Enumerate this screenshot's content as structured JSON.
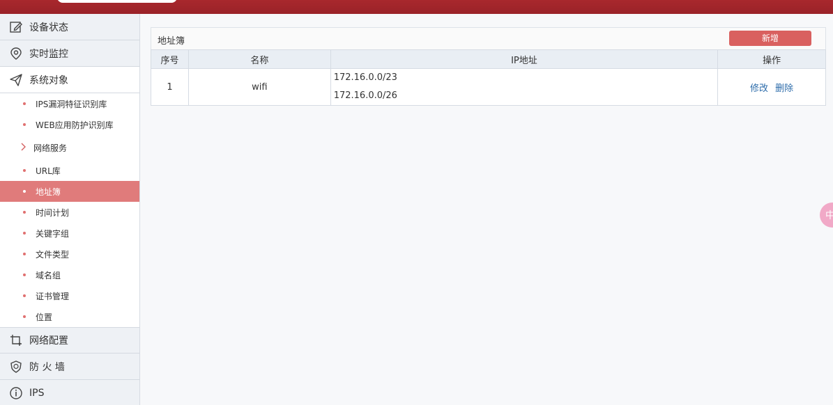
{
  "sidebar": {
    "top_items": [
      {
        "label": "设备状态",
        "icon": "edit-icon"
      },
      {
        "label": "实时监控",
        "icon": "location-pin-icon"
      },
      {
        "label": "系统对象",
        "icon": "paper-plane-icon"
      }
    ],
    "sub_items": [
      {
        "label": "IPS漏洞特征识别库"
      },
      {
        "label": "WEB应用防护识别库"
      },
      {
        "label": "网络服务"
      },
      {
        "label": "URL库"
      },
      {
        "label": "地址簿"
      },
      {
        "label": "时间计划"
      },
      {
        "label": "关键字组"
      },
      {
        "label": "文件类型"
      },
      {
        "label": "域名组"
      },
      {
        "label": "证书管理"
      },
      {
        "label": "位置"
      }
    ],
    "bottom_items": [
      {
        "label": "网络配置",
        "icon": "crop-icon"
      },
      {
        "label": "防 火 墙",
        "icon": "shield-icon"
      },
      {
        "label": "IPS",
        "icon": "info-icon"
      }
    ]
  },
  "main": {
    "title": "地址簿",
    "add_button": "新增",
    "columns": [
      "序号",
      "名称",
      "IP地址",
      "操作"
    ],
    "rows": [
      {
        "index": "1",
        "name": "wifi",
        "ips": [
          "172.16.0.0/23",
          "172.16.0.0/26"
        ],
        "actions": [
          "修改",
          "删除"
        ]
      }
    ]
  },
  "float_widget": "中",
  "colors": {
    "brand": "#a8282d",
    "accent": "#d9605f",
    "selected": "#e07b7b",
    "link": "#2e6dab"
  }
}
